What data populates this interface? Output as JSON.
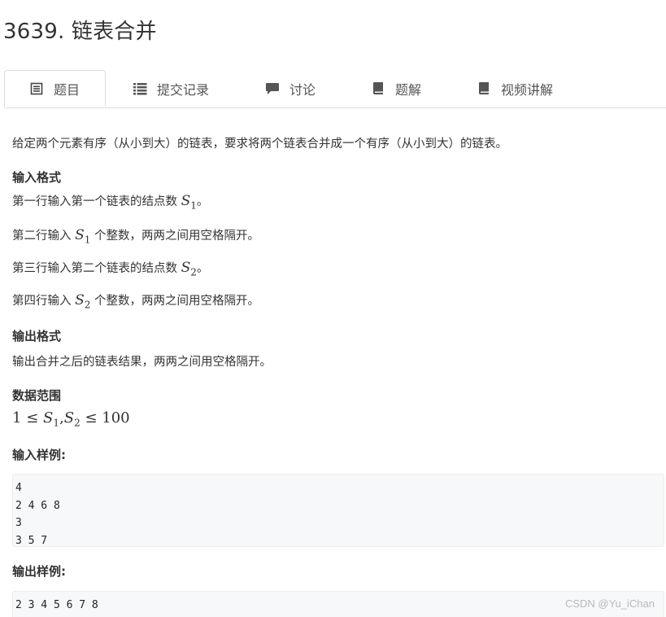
{
  "title": "3639. 链表合并",
  "tabs": [
    {
      "label": "题目",
      "icon": "document-icon"
    },
    {
      "label": "提交记录",
      "icon": "list-icon"
    },
    {
      "label": "讨论",
      "icon": "comment-icon"
    },
    {
      "label": "题解",
      "icon": "book-icon"
    },
    {
      "label": "视频讲解",
      "icon": "book-icon"
    }
  ],
  "description": "给定两个元素有序（从小到大）的链表，要求将两个链表合并成一个有序（从小到大）的链表。",
  "input_format": {
    "heading": "输入格式",
    "lines": [
      {
        "before": "第一行输入第一个链表的结点数 ",
        "var": "S",
        "sub": "1",
        "after": "。"
      },
      {
        "before": "第二行输入 ",
        "var": "S",
        "sub": "1",
        "after": " 个整数，两两之间用空格隔开。"
      },
      {
        "before": "第三行输入第二个链表的结点数 ",
        "var": "S",
        "sub": "2",
        "after": "。"
      },
      {
        "before": "第四行输入 ",
        "var": "S",
        "sub": "2",
        "after": " 个整数，两两之间用空格隔开。"
      }
    ]
  },
  "output_format": {
    "heading": "输出格式",
    "text": "输出合并之后的链表结果，两两之间用空格隔开。"
  },
  "range": {
    "heading": "数据范围",
    "lower": "1",
    "le1": "≤",
    "var1": "S",
    "sub1": "1",
    "comma": ",",
    "var2": "S",
    "sub2": "2",
    "le2": "≤",
    "upper": "100"
  },
  "sample_input": {
    "heading": "输入样例:",
    "lines": [
      "4",
      "2 4 6 8",
      "3",
      "3 5 7"
    ]
  },
  "sample_output": {
    "heading": "输出样例:",
    "lines": [
      "2 3 4 5 6 7 8"
    ]
  },
  "watermark": "CSDN @Yu_iChan"
}
